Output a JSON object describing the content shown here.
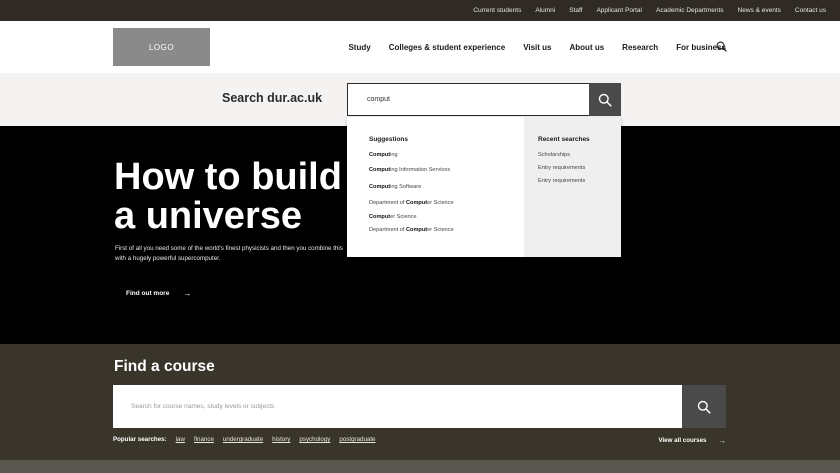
{
  "utility_nav": [
    "Current students",
    "Alumni",
    "Staff",
    "Applicant Portal",
    "Academic Departments",
    "News & events",
    "Contact us"
  ],
  "logo": "LOGO",
  "main_nav": [
    "Study",
    "Colleges & student experience",
    "Visit us",
    "About us",
    "Research",
    "For business"
  ],
  "search": {
    "heading": "Search dur.ac.uk",
    "value": "comput",
    "button_icon": "search-icon"
  },
  "dropdown": {
    "suggestions_heading": "Suggestions",
    "suggestions": [
      {
        "match": "Comput",
        "rest": "ing"
      },
      {
        "match": "Comput",
        "rest": "ing Information Services"
      },
      {
        "match": "Comput",
        "rest": "ing Software"
      },
      {
        "pre": "Department of ",
        "match": "Comput",
        "rest": "er Science"
      },
      {
        "match": "Comput",
        "rest": "er Science"
      },
      {
        "pre": "Department of ",
        "match": "Comput",
        "rest": "er Science"
      }
    ],
    "recent_heading": "Recent searches",
    "recent": [
      "Scholarships",
      "Entry requirements",
      "Entry requirements"
    ]
  },
  "hero": {
    "title_line1": "How to build",
    "title_line2": "a universe",
    "text": "First of all you need some of the world's finest physicists and then you combine this with a hugely powerful supercomputer.",
    "link": "Find out more",
    "link_arrow": "→"
  },
  "course_search": {
    "title": "Find a course",
    "placeholder": "Search for course names, study levels or subjects",
    "popular_label": "Popular searches:",
    "popular": [
      "law",
      "finance",
      "undergraduate",
      "history",
      "psychology",
      "postgraduate"
    ],
    "view_all": "View all courses",
    "view_all_arrow": "→"
  },
  "colors": {
    "topbar": "#2f2b24",
    "course_band": "#3a352a",
    "button": "#4a4a4a"
  }
}
